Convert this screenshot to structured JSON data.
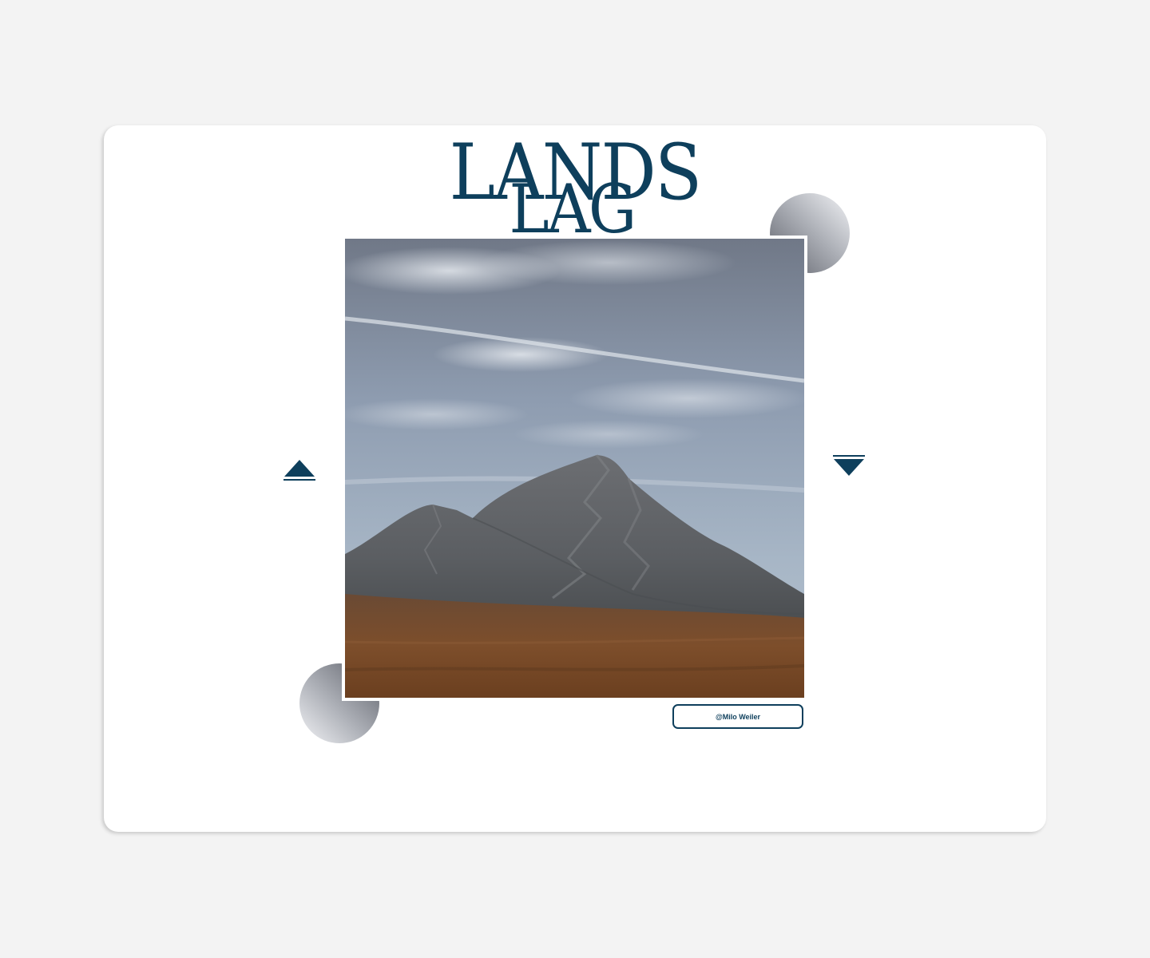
{
  "title": {
    "line1": "LANDS",
    "line2": "LAG"
  },
  "photo": {
    "subject": "mountain landscape under a cloudy sky"
  },
  "nav": {
    "prev_icon": "triangle-up-icon",
    "next_icon": "triangle-down-icon"
  },
  "credit": {
    "label": "@Milo Weiler"
  },
  "colors": {
    "accent": "#0e3f5c",
    "card": "#ffffff",
    "background": "#f3f3f3"
  }
}
